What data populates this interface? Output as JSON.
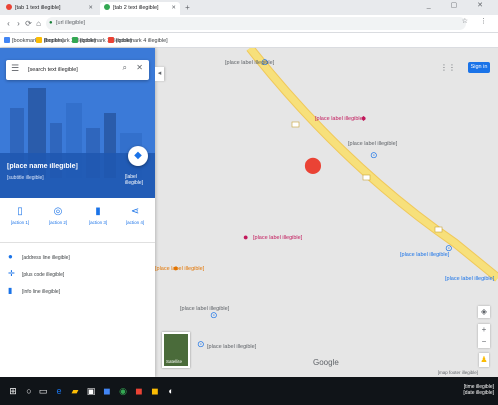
{
  "browser": {
    "tabs": [
      {
        "label": "[tab 1 text illegible]",
        "favicon_color": "#ea4335"
      },
      {
        "label": "[tab 2 text illegible]",
        "favicon_color": "#34a853"
      }
    ],
    "new_tab_glyph": "+",
    "window_controls": "_ ▢ ✕",
    "nav": {
      "back": "‹",
      "forward": "›",
      "reload": "⟳",
      "home": "⌂"
    },
    "url": "[url illegible]",
    "lock_glyph": "🔒",
    "omni_right": "☆ ⋮",
    "bookmarks": [
      {
        "label": "[bookmark 1 illegible]",
        "color": "#4285f4"
      },
      {
        "label": "[bookmark 2 illegible]",
        "color": "#fbbc04"
      },
      {
        "label": "[bookmark 3 illegible]",
        "color": "#34a853"
      },
      {
        "label": "[bookmark 4 illegible]",
        "color": "#ea4335"
      }
    ]
  },
  "panel": {
    "search_value": "[search text illegible]",
    "place_name": "[place name illegible]",
    "place_subtitle": "[subtitle illegible]",
    "directions_label": "[label illegible]",
    "actions": [
      {
        "icon": "▯",
        "label": "[action 1]"
      },
      {
        "icon": "◎",
        "label": "[action 2]"
      },
      {
        "icon": "▮",
        "label": "[action 3]"
      },
      {
        "icon": "⋖",
        "label": "[action 4]"
      }
    ],
    "info": [
      {
        "icon": "●",
        "text": "[address line illegible]"
      },
      {
        "icon": "✛",
        "text": "[plus code illegible]"
      },
      {
        "icon": "▮",
        "text": "[info line illegible]"
      }
    ]
  },
  "map": {
    "signin_label": "Sign in",
    "google_label": "Google",
    "satellite_label": "Satellite",
    "scale_text": "[map footer illegible]",
    "zoom_in": "+",
    "zoom_out": "−",
    "labels": [
      {
        "text": "[place label illegible]",
        "color": "#5f6368"
      },
      {
        "text": "[place label illegible]",
        "color": "#c2185b"
      },
      {
        "text": "[place label illegible]",
        "color": "#5f6368"
      },
      {
        "text": "[place label illegible]",
        "color": "#c2185b"
      },
      {
        "text": "[place label illegible]",
        "color": "#1a73e8"
      },
      {
        "text": "[place label illegible]",
        "color": "#1a73e8"
      },
      {
        "text": "[place label illegible]",
        "color": "#e37400"
      },
      {
        "text": "[place label illegible]",
        "color": "#5f6368"
      },
      {
        "text": "[place label illegible]",
        "color": "#5f6368"
      }
    ],
    "road_color": "#f7e07b",
    "pin_color": "#ea4335"
  },
  "taskbar": {
    "tray_time": "[time illegible]",
    "tray_date": "[date illegible]"
  }
}
